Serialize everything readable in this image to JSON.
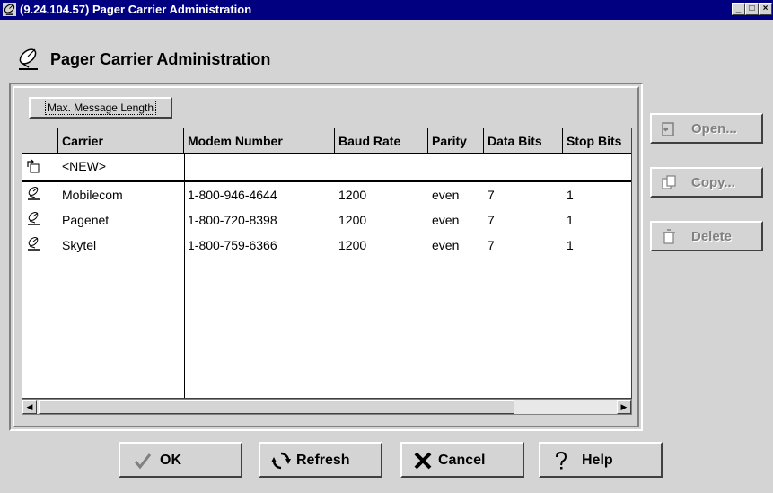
{
  "window": {
    "title": "(9.24.104.57) Pager Carrier Administration",
    "controls": {
      "minimize": "_",
      "maximize": "□",
      "close": "×"
    }
  },
  "header": {
    "title": "Pager Carrier Administration",
    "icon": "satellite-dish-icon"
  },
  "max_message_button": {
    "label": "Max. Message Length"
  },
  "table": {
    "columns": [
      "Carrier",
      "Modem Number",
      "Baud Rate",
      "Parity",
      "Data Bits",
      "Stop Bits"
    ],
    "new_row": {
      "label": "<NEW>",
      "icon": "new-entry-icon"
    },
    "rows": [
      {
        "carrier": "Mobilecom",
        "modem": "1-800-946-4644",
        "baud": "1200",
        "parity": "even",
        "data_bits": "7",
        "stop_bits": "1"
      },
      {
        "carrier": "Pagenet",
        "modem": "1-800-720-8398",
        "baud": "1200",
        "parity": "even",
        "data_bits": "7",
        "stop_bits": "1"
      },
      {
        "carrier": "Skytel",
        "modem": "1-800-759-6366",
        "baud": "1200",
        "parity": "even",
        "data_bits": "7",
        "stop_bits": "1"
      }
    ],
    "row_icon": "satellite-dish-icon"
  },
  "side_buttons": {
    "open": "Open...",
    "copy": "Copy...",
    "delete": "Delete"
  },
  "bottom_buttons": {
    "ok": "OK",
    "refresh": "Refresh",
    "cancel": "Cancel",
    "help": "Help"
  },
  "colors": {
    "titlebar": "#000080",
    "window_bg": "#d4d4d4",
    "ok_check": "#808080"
  }
}
